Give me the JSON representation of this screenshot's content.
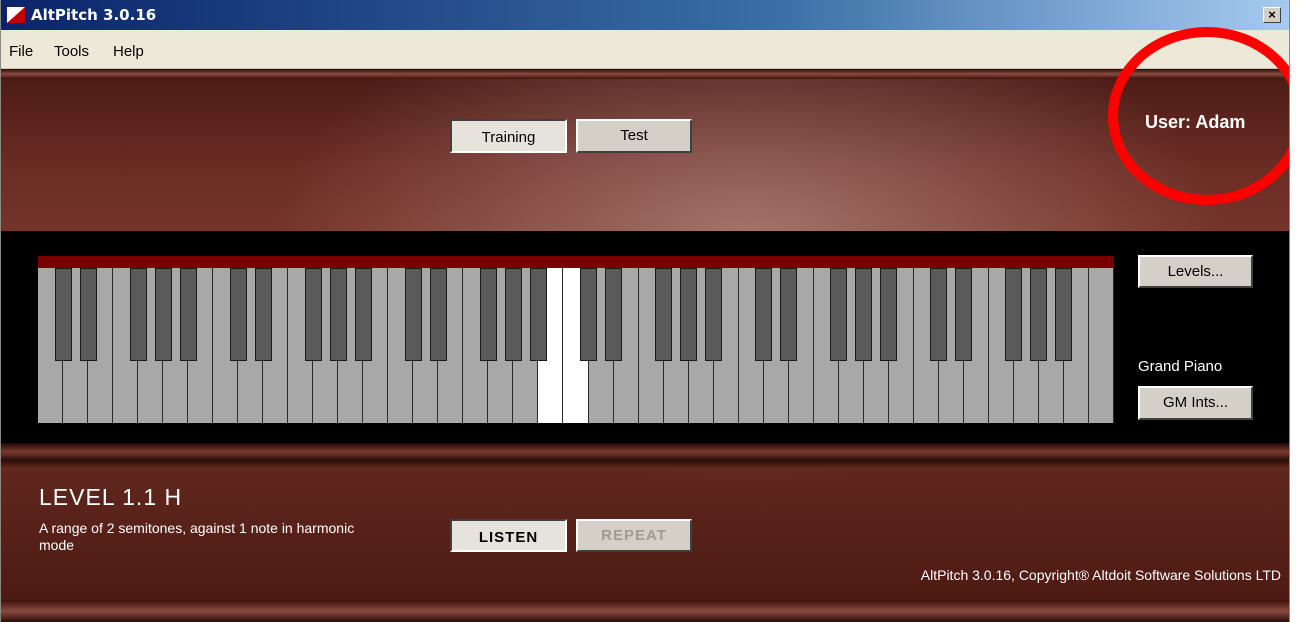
{
  "window": {
    "title": "AltPitch 3.0.16",
    "close_label": "×"
  },
  "menu": [
    "File",
    "Tools",
    "Help"
  ],
  "modes": {
    "training_label": "Training",
    "test_label": "Test",
    "active": "Training"
  },
  "user": {
    "label": "User: Adam"
  },
  "keyboard": {
    "white_key_count": 43,
    "lit_white_keys": [
      20,
      21
    ],
    "lit_black_keys": [
      21
    ],
    "levels_label": "Levels...",
    "instrument": "Grand Piano",
    "gm_label": "GM Ints..."
  },
  "level": {
    "title": "LEVEL 1.1 H",
    "description": "A range of 2 semitones, against 1 note in harmonic mode"
  },
  "controls": {
    "listen_label": "LISTEN",
    "repeat_label": "REPEAT"
  },
  "footer": {
    "copyright": "AltPitch 3.0.16, Copyright® Altdoit Software Solutions LTD"
  },
  "colors": {
    "accent_red": "#ff0000",
    "key_bar": "#7a0000",
    "white_key": "#a8a8a8",
    "black_key": "#5a5a5a"
  }
}
